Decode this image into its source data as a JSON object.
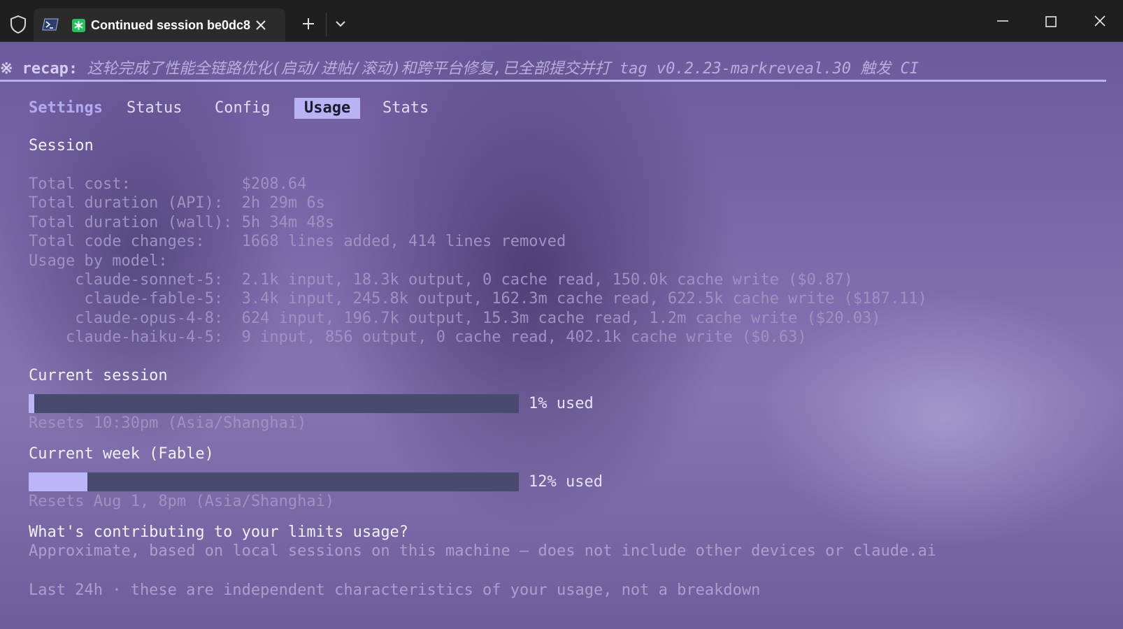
{
  "window": {
    "tab_title": "Continued session be0dc8",
    "icons": {
      "security": "shield-icon",
      "shell": "powershell-icon",
      "app": "asterisk-icon",
      "close_tab": "close-icon",
      "new_tab": "plus-icon",
      "dropdown": "chevron-down-icon",
      "minimize": "minimize-icon",
      "maximize": "maximize-icon",
      "close_window": "close-icon"
    }
  },
  "recap": {
    "label": "※ recap:",
    "text": " 这轮完成了性能全链路优化(启动/进帖/滚动)和跨平台修复,已全部提交并打 tag v0.2.23-markreveal.30 触发 CI"
  },
  "tabs": [
    {
      "label": "Settings"
    },
    {
      "label": "Status"
    },
    {
      "label": "Config"
    },
    {
      "label": "Usage",
      "active": true
    },
    {
      "label": "Stats"
    }
  ],
  "session": {
    "heading": "Session",
    "lines": [
      "Total cost:            $208.64",
      "Total duration (API):  2h 29m 6s",
      "Total duration (wall): 5h 34m 48s",
      "Total code changes:    1668 lines added, 414 lines removed",
      "Usage by model:",
      "     claude-sonnet-5:  2.1k input, 18.3k output, 0 cache read, 150.0k cache write ($0.87)",
      "      claude-fable-5:  3.4k input, 245.8k output, 162.3m cache read, 622.5k cache write ($187.11)",
      "     claude-opus-4-8:  624 input, 196.7k output, 15.3m cache read, 1.2m cache write ($20.03)",
      "    claude-haiku-4-5:  9 input, 856 output, 0 cache read, 402.1k cache write ($0.63)"
    ]
  },
  "limits": [
    {
      "title": "Current session",
      "percent": 1,
      "used_label": "1% used",
      "resets": "Resets 10:30pm (Asia/Shanghai)"
    },
    {
      "title": "Current week (Fable)",
      "percent": 12,
      "used_label": "12% used",
      "resets": "Resets Aug 1, 8pm (Asia/Shanghai)"
    }
  ],
  "contrib": {
    "question": "What's contributing to your limits usage?",
    "note": "Approximate, based on local sessions on this machine — does not include other devices or claude.ai",
    "last24": "Last 24h · these are independent characteristics of your usage, not a breakdown"
  },
  "colors": {
    "accent": "#b9b3f5",
    "bar_track": "#4a4a6e",
    "app_icon": "#23c25a"
  }
}
